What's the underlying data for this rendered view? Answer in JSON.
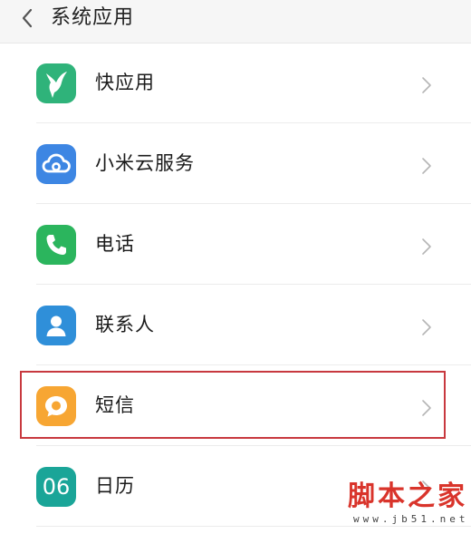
{
  "header": {
    "title": "系统应用",
    "back_icon": "chevron-left-icon"
  },
  "items": [
    {
      "label": "快应用",
      "icon": "hummingbird-icon",
      "icon_color": "#2fb37a"
    },
    {
      "label": "小米云服务",
      "icon": "cloud-icon",
      "icon_color": "#3d86e3"
    },
    {
      "label": "电话",
      "icon": "phone-icon",
      "icon_color": "#2bb55d"
    },
    {
      "label": "联系人",
      "icon": "contact-person-icon",
      "icon_color": "#2f8fd9"
    },
    {
      "label": "短信",
      "icon": "chat-bubble-icon",
      "icon_color": "#f7a633",
      "highlighted": true
    },
    {
      "label": "日历",
      "icon": "calendar-icon",
      "icon_color": "#1aa598",
      "icon_text": "06"
    }
  ],
  "highlight_color": "#c8393f",
  "watermark": {
    "main": "脚本之家",
    "url": "www.jb51.net"
  }
}
